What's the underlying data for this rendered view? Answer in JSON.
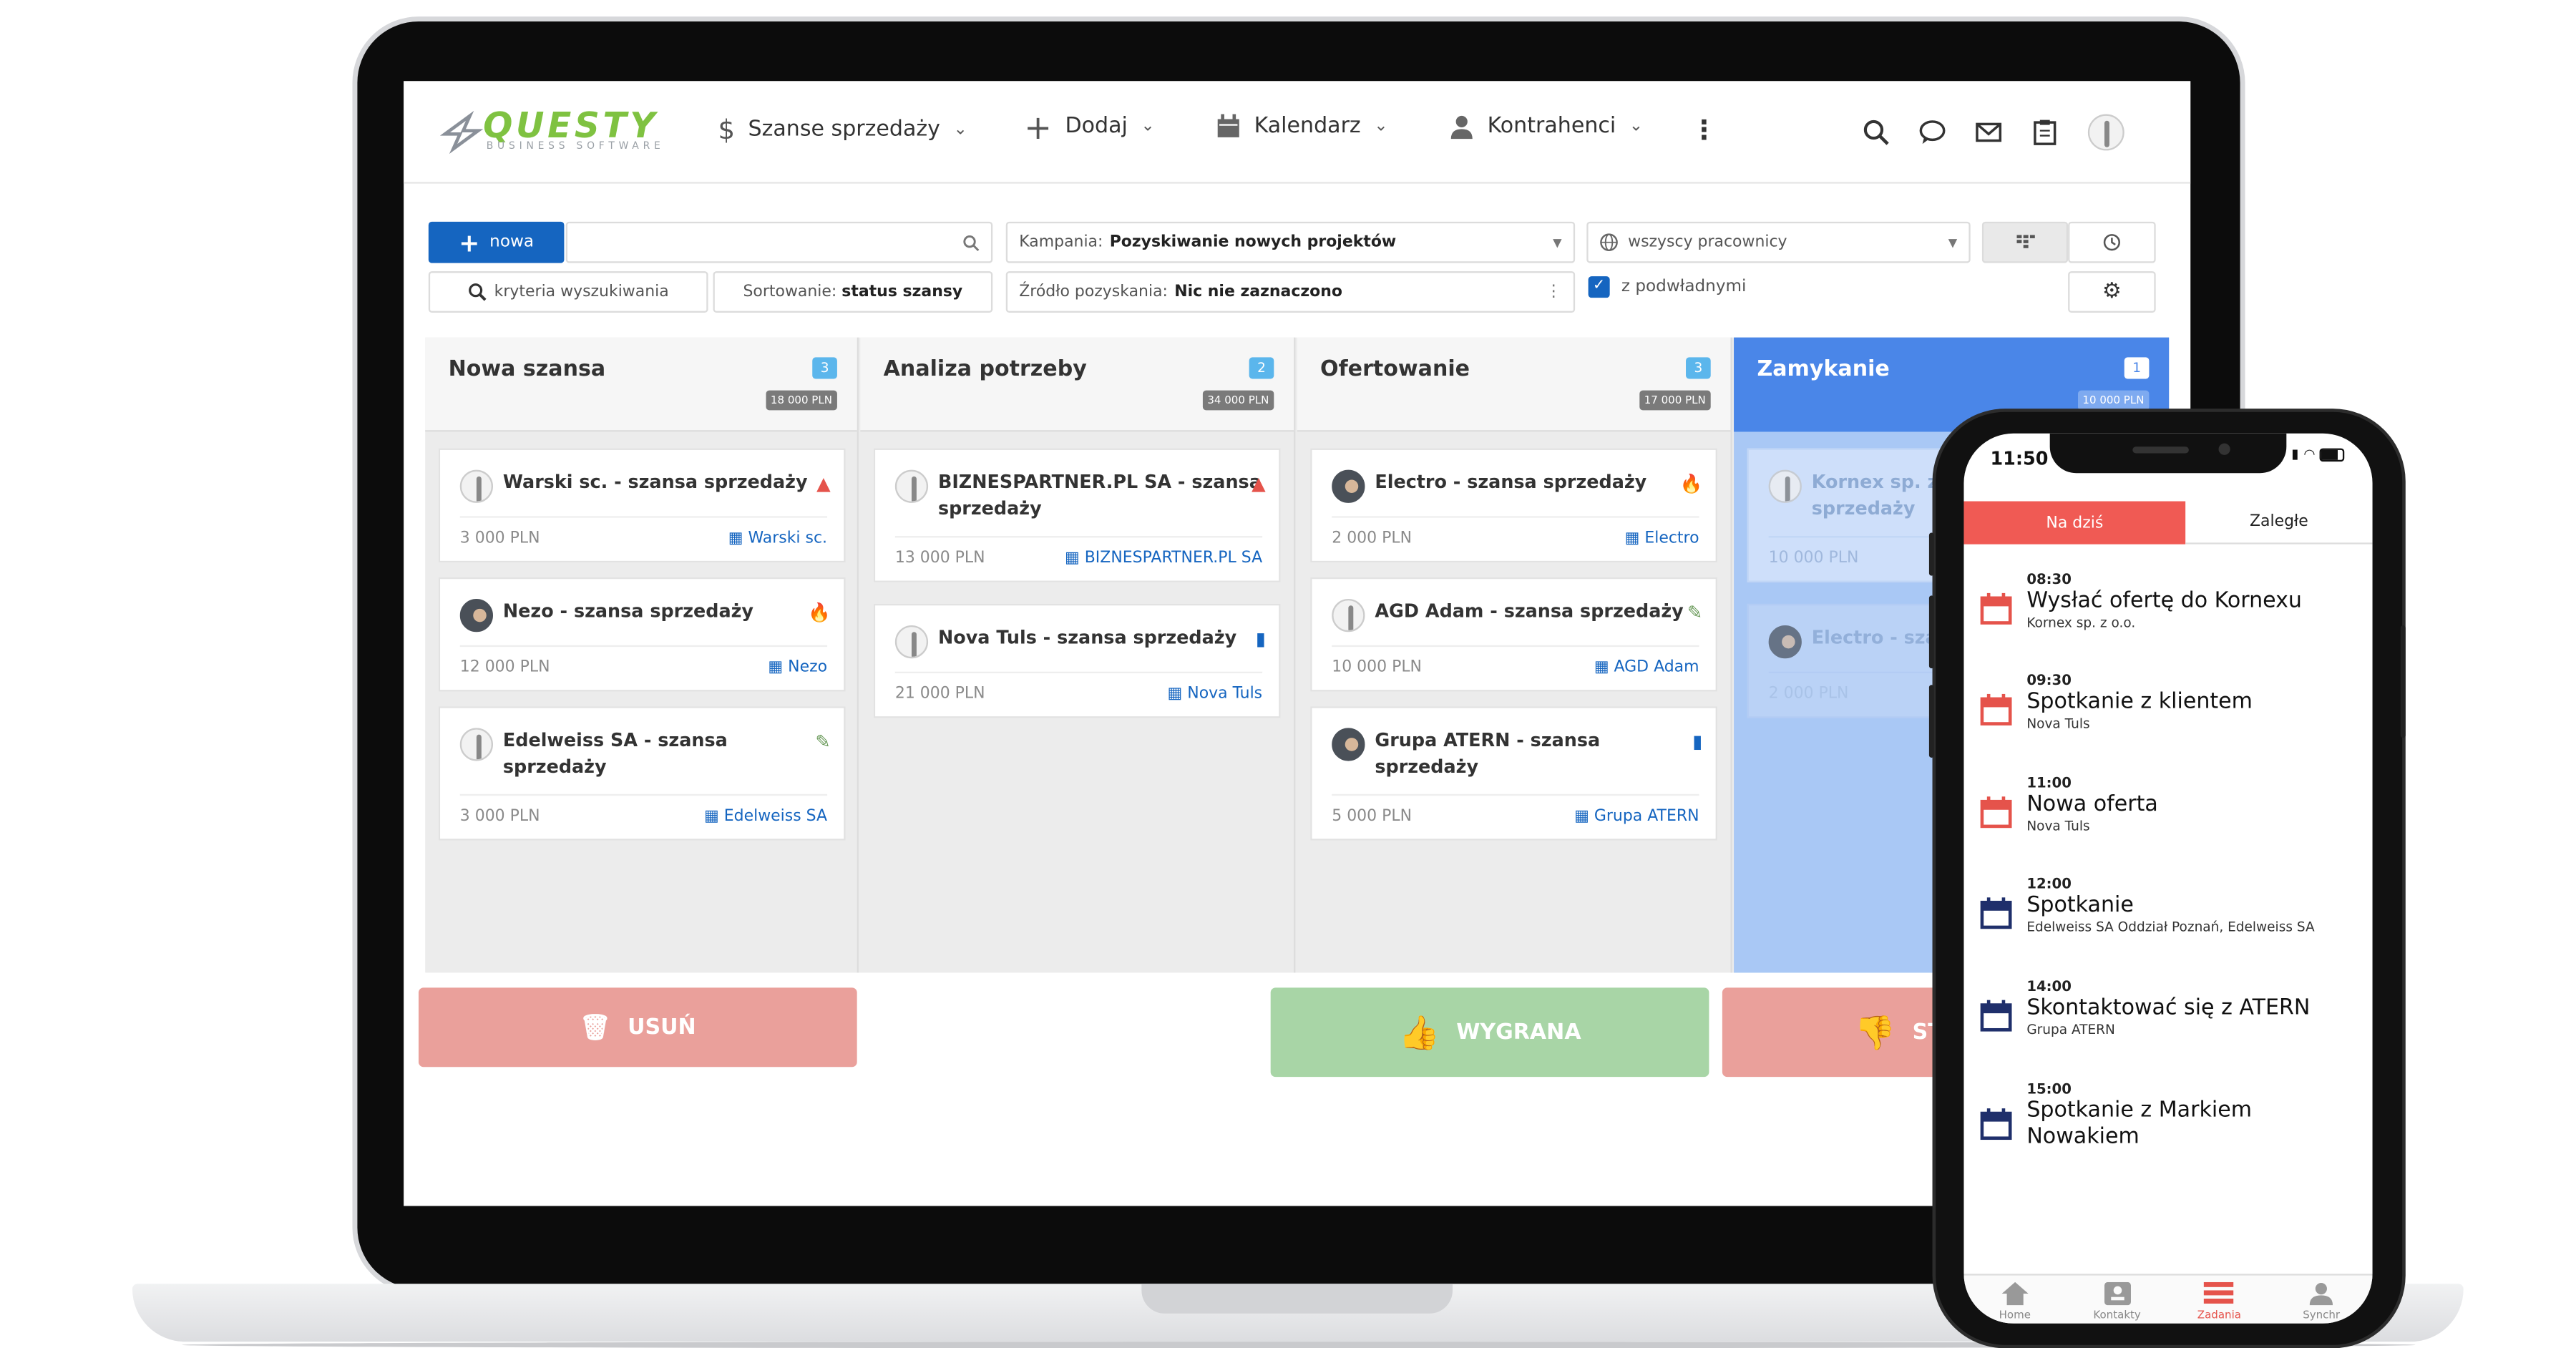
{
  "header": {
    "logo_text": "QUESTY",
    "logo_sub": "BUSINESS SOFTWARE",
    "nav": [
      {
        "label": "Szanse sprzedaży",
        "icon": "dollar-icon"
      },
      {
        "label": "Dodaj",
        "icon": "plus-icon"
      },
      {
        "label": "Kalendarz",
        "icon": "calendar-icon"
      },
      {
        "label": "Kontrahenci",
        "icon": "user-icon"
      }
    ],
    "icons": [
      "search-icon",
      "chat-icon",
      "mail-icon",
      "clipboard-icon",
      "avatar"
    ]
  },
  "filters": {
    "new_button": "nowa",
    "search_placeholder": "",
    "criteria": "kryteria wyszukiwania",
    "sort_label": "Sortowanie:",
    "sort_value": "status szansy",
    "campaign_label": "Kampania:",
    "campaign_value": "Pozyskiwanie nowych projektów",
    "source_label": "Źródło pozyskania:",
    "source_value": "Nic nie zaznaczono",
    "employees": "wszyscy pracownicy",
    "subordinates": "z podwładnymi"
  },
  "columns": [
    {
      "title": "Nowa szansa",
      "count": "3",
      "sum": "18 000 PLN",
      "cards": [
        {
          "title": "Warski sc. - szansa sprzedaży",
          "amount": "3 000 PLN",
          "company": "Warski sc.",
          "flag": "warning"
        },
        {
          "title": "Nezo - szansa sprzedaży",
          "amount": "12 000 PLN",
          "company": "Nezo",
          "flag": "fire"
        },
        {
          "title": "Edelweiss SA - szansa sprzedaży",
          "amount": "3 000 PLN",
          "company": "Edelweiss SA",
          "flag": "edit"
        }
      ]
    },
    {
      "title": "Analiza potrzeby",
      "count": "2",
      "sum": "34 000 PLN",
      "cards": [
        {
          "title": "BIZNESPARTNER.PL SA - szansa sprzedaży",
          "amount": "13 000 PLN",
          "company": "BIZNESPARTNER.PL SA",
          "flag": "warning"
        },
        {
          "title": "Nova Tuls - szansa sprzedaży",
          "amount": "21 000 PLN",
          "company": "Nova Tuls",
          "flag": "bookmark"
        }
      ]
    },
    {
      "title": "Ofertowanie",
      "count": "3",
      "sum": "17 000 PLN",
      "cards": [
        {
          "title": "Electro - szansa sprzedaży",
          "amount": "2 000 PLN",
          "company": "Electro",
          "flag": "fire"
        },
        {
          "title": "AGD Adam - szansa sprzedaży",
          "amount": "10 000 PLN",
          "company": "AGD Adam",
          "flag": "edit"
        },
        {
          "title": "Grupa ATERN - szansa sprzedaży",
          "amount": "5 000 PLN",
          "company": "Grupa ATERN",
          "flag": "bookmark"
        }
      ]
    },
    {
      "title": "Zamykanie",
      "count": "1",
      "sum": "10 000 PLN",
      "cards": [
        {
          "title": "Kornex sp. z o.o. - szansa sprzedaży",
          "amount": "10 000 PLN"
        },
        {
          "title": "Electro - szansa sprzedaży",
          "amount": "2 000 PLN"
        }
      ]
    }
  ],
  "actions": {
    "delete": "USUŃ",
    "won": "WYGRANA",
    "lost": "ST"
  },
  "phone": {
    "time": "11:50",
    "tabs": [
      "Na dziś",
      "Zaległe"
    ],
    "tasks": [
      {
        "time": "08:30",
        "title": "Wysłać ofertę do Kornexu",
        "sub": "Kornex sp. z o.o.",
        "color": "#e5534b"
      },
      {
        "time": "09:30",
        "title": "Spotkanie z klientem",
        "sub": "Nova Tuls",
        "color": "#e5534b"
      },
      {
        "time": "11:00",
        "title": "Nowa oferta",
        "sub": "Nova Tuls",
        "color": "#e5534b"
      },
      {
        "time": "12:00",
        "title": "Spotkanie",
        "sub": "Edelweiss SA Oddział Poznań, Edelweiss SA",
        "color": "#1f2f6b"
      },
      {
        "time": "14:00",
        "title": "Skontaktować się z ATERN",
        "sub": "Grupa ATERN",
        "color": "#1f2f6b"
      },
      {
        "time": "15:00",
        "title": "Spotkanie z Markiem Nowakiem",
        "sub": "",
        "color": "#1f2f6b"
      }
    ],
    "nav": [
      {
        "label": "Home",
        "icon": "home-icon"
      },
      {
        "label": "Kontakty",
        "icon": "contacts-icon"
      },
      {
        "label": "Zadania",
        "icon": "tasks-icon"
      },
      {
        "label": "Synchr",
        "icon": "sync-icon"
      }
    ]
  },
  "colors": {
    "accent": "#1565c0",
    "closing": "#4a86e8",
    "danger": "#e5534b",
    "won": "#a8d5a6",
    "delete": "#eaa09b"
  }
}
